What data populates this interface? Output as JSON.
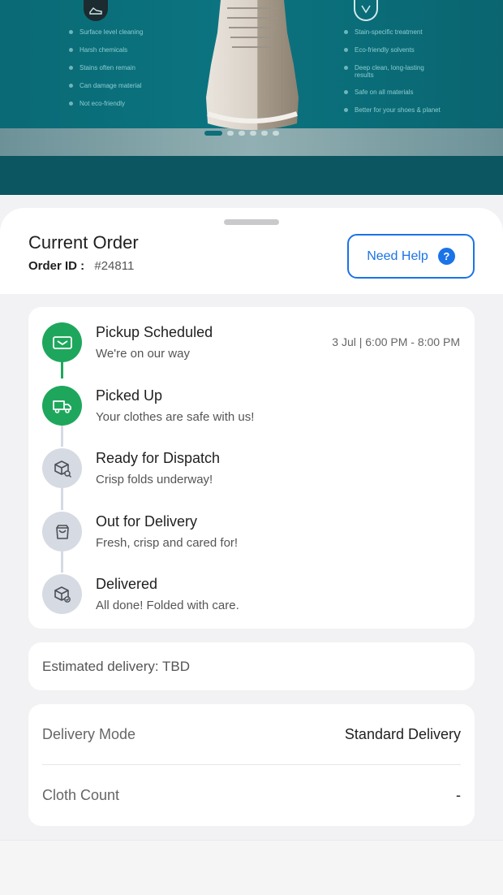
{
  "banner": {
    "left_items": [
      "Surface level cleaning",
      "Harsh chemicals",
      "Stains often remain",
      "Can damage material",
      "Not eco-friendly"
    ],
    "right_items": [
      "Stain-specific treatment",
      "Eco-friendly solvents",
      "Deep clean, long-lasting results",
      "Safe on all materials",
      "Better for your shoes & planet"
    ],
    "carousel_active_index": 0,
    "carousel_count": 6
  },
  "order": {
    "title": "Current Order",
    "id_label": "Order ID :",
    "id_value": "#24811",
    "help_label": "Need Help",
    "help_icon": "?"
  },
  "timeline": {
    "steps": [
      {
        "title": "Pickup Scheduled",
        "subtitle": "We're on our way",
        "time": "3 Jul | 6:00 PM - 8:00 PM",
        "status": "done",
        "icon": "ticket-icon"
      },
      {
        "title": "Picked Up",
        "subtitle": "Your clothes are safe with us!",
        "time": "",
        "status": "done",
        "icon": "truck-icon"
      },
      {
        "title": "Ready for Dispatch",
        "subtitle": "Crisp folds underway!",
        "time": "",
        "status": "pending",
        "icon": "box-search-icon"
      },
      {
        "title": "Out for Delivery",
        "subtitle": "Fresh, crisp and cared for!",
        "time": "",
        "status": "pending",
        "icon": "bag-icon"
      },
      {
        "title": "Delivered",
        "subtitle": "All done! Folded with care.",
        "time": "",
        "status": "pending",
        "icon": "box-check-icon"
      }
    ]
  },
  "estimate": {
    "text": "Estimated delivery: TBD"
  },
  "details": [
    {
      "label": "Delivery Mode",
      "value": "Standard Delivery"
    },
    {
      "label": "Cloth Count",
      "value": "-"
    }
  ],
  "colors": {
    "done": "#1ea75c",
    "pending": "#d6dae3",
    "accent": "#1a73e8",
    "banner": "#0b7480"
  }
}
